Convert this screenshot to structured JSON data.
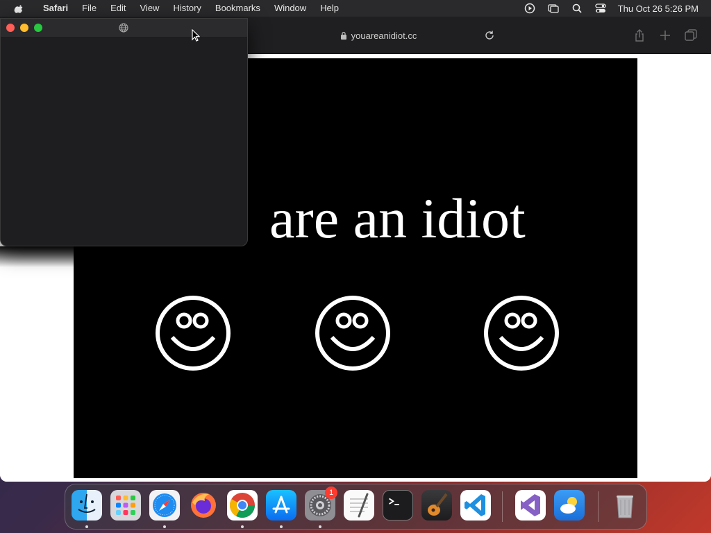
{
  "menubar": {
    "app_name": "Safari",
    "items": [
      "File",
      "Edit",
      "View",
      "History",
      "Bookmarks",
      "Window",
      "Help"
    ],
    "clock": "Thu Oct 26  5:26 PM"
  },
  "safari": {
    "url": "youareanidiot.cc"
  },
  "page": {
    "headline": "are an idiot"
  },
  "dock": {
    "apps": [
      {
        "name": "Finder",
        "icon": "finder-icon"
      },
      {
        "name": "Launchpad",
        "icon": "launchpad-icon"
      },
      {
        "name": "Safari",
        "icon": "safari-icon"
      },
      {
        "name": "Firefox",
        "icon": "firefox-icon"
      },
      {
        "name": "Chrome",
        "icon": "chrome-icon"
      },
      {
        "name": "App Store",
        "icon": "app-store-icon"
      },
      {
        "name": "System Settings",
        "icon": "system-settings-icon"
      },
      {
        "name": "TextEdit",
        "icon": "textedit-icon"
      },
      {
        "name": "Terminal",
        "icon": "terminal-icon"
      },
      {
        "name": "GarageBand",
        "icon": "garageband-icon"
      },
      {
        "name": "Visual Studio Code",
        "icon": "vscode-icon"
      },
      {
        "name": "Visual Studio",
        "icon": "visual-studio-icon"
      },
      {
        "name": "Weather",
        "icon": "weather-icon"
      },
      {
        "name": "Trash",
        "icon": "trash-icon"
      }
    ],
    "settings_badge": "1"
  }
}
